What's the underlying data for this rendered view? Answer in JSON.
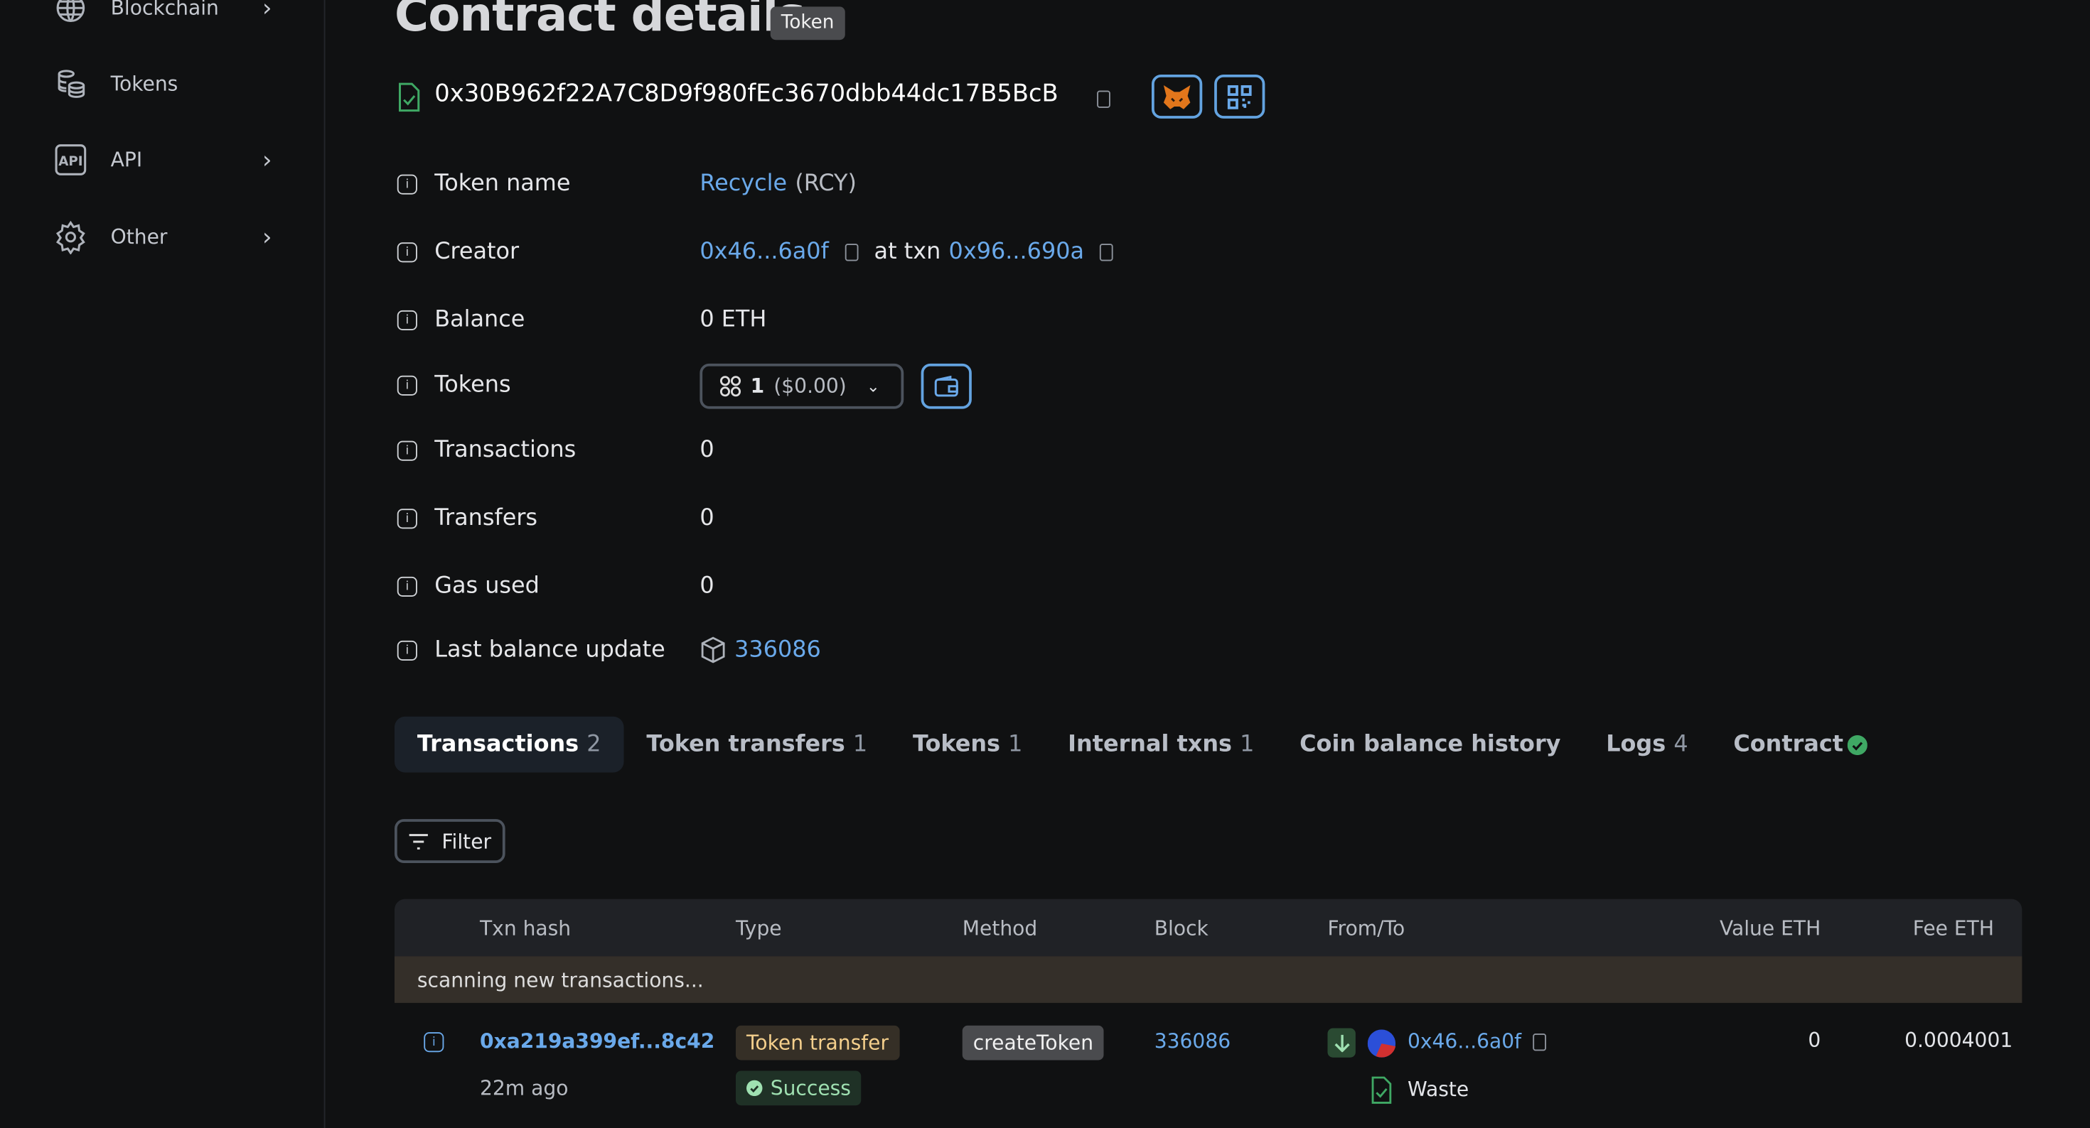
{
  "sidebar": {
    "items": [
      {
        "label": "Blockchain",
        "icon": "globe-icon",
        "has_submenu": true
      },
      {
        "label": "Tokens",
        "icon": "coins-icon",
        "has_submenu": false
      },
      {
        "label": "API",
        "icon": "api-icon",
        "has_submenu": true
      },
      {
        "label": "Other",
        "icon": "gear-icon",
        "has_submenu": true
      }
    ]
  },
  "header": {
    "title": "Contract details",
    "badge": "Token"
  },
  "address": {
    "value": "0x30B962f22A7C8D9f980fEc3670dbb44dc17B5BcB",
    "buttons": [
      "metamask-icon",
      "qr-code-icon"
    ]
  },
  "details": {
    "token_name": {
      "label": "Token name",
      "name": "Recycle",
      "symbol": "(RCY)"
    },
    "creator": {
      "label": "Creator",
      "address": "0x46...6a0f",
      "at_txn": "at txn",
      "txn": "0x96...690a"
    },
    "balance": {
      "label": "Balance",
      "value": "0 ETH"
    },
    "tokens": {
      "label": "Tokens",
      "value": "1",
      "usd": "($0.00)"
    },
    "transactions": {
      "label": "Transactions",
      "value": "0"
    },
    "transfers": {
      "label": "Transfers",
      "value": "0"
    },
    "gas_used": {
      "label": "Gas used",
      "value": "0"
    },
    "last_balance_update": {
      "label": "Last balance update",
      "value": "336086"
    }
  },
  "tabs": [
    {
      "label": "Transactions",
      "count": "2",
      "active": true
    },
    {
      "label": "Token transfers",
      "count": "1"
    },
    {
      "label": "Tokens",
      "count": "1"
    },
    {
      "label": "Internal txns",
      "count": "1"
    },
    {
      "label": "Coin balance history",
      "count": ""
    },
    {
      "label": "Logs",
      "count": "4"
    },
    {
      "label": "Contract",
      "count": "",
      "verified": true
    }
  ],
  "filter_label": "Filter",
  "table": {
    "columns": [
      "Txn hash",
      "Type",
      "Method",
      "Block",
      "From/To",
      "Value ETH",
      "Fee ETH"
    ],
    "notice": "scanning new transactions...",
    "rows": [
      {
        "hash": "0xa219a399ef...8c42",
        "age": "22m ago",
        "type": "Token transfer",
        "status": "Success",
        "method": "createToken",
        "block": "336086",
        "from": "0x46...6a0f",
        "to": "Waste",
        "value": "0",
        "fee": "0.0004001"
      }
    ]
  },
  "colors": {
    "accent": "#6aa9ea",
    "success": "#3fa864",
    "background": "#101112"
  }
}
